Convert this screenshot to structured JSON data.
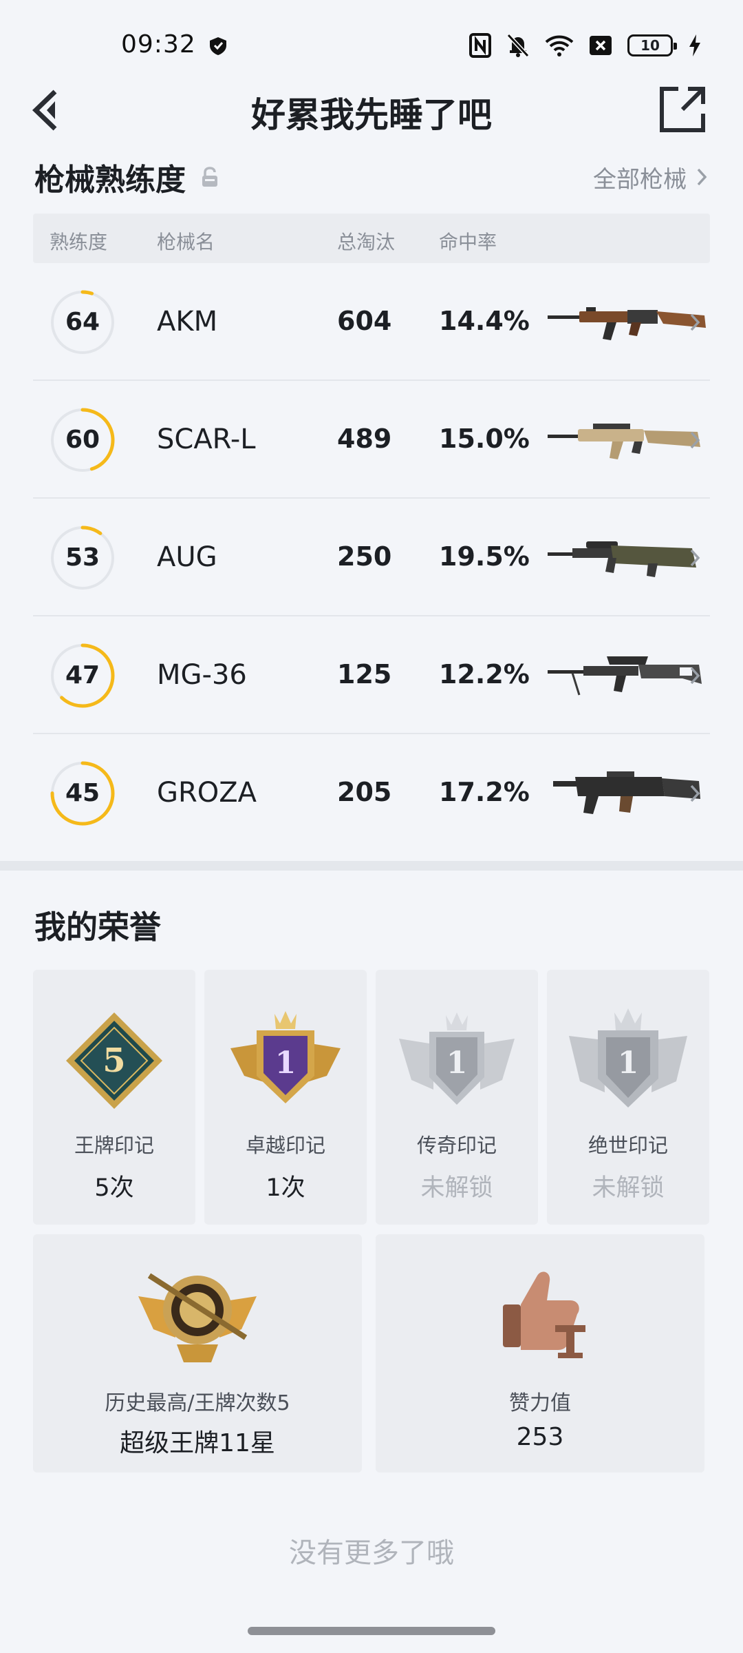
{
  "status_bar": {
    "time": "09:32",
    "battery_level": "10",
    "icons": [
      "shield-icon",
      "nfc-icon",
      "bell-muted-icon",
      "wifi-icon",
      "sim-off-icon",
      "battery-icon",
      "charging-icon"
    ]
  },
  "header": {
    "title": "好累我先睡了吧"
  },
  "weapons_section": {
    "title": "枪械熟练度",
    "all_link": "全部枪械",
    "columns": [
      "熟练度",
      "枪械名",
      "总淘汰",
      "命中率"
    ],
    "rows": [
      {
        "level": "64",
        "name": "AKM",
        "eliminations": "604",
        "hit_rate": "14.4%",
        "progress": 0.05
      },
      {
        "level": "60",
        "name": "SCAR-L",
        "eliminations": "489",
        "hit_rate": "15.0%",
        "progress": 0.45
      },
      {
        "level": "53",
        "name": "AUG",
        "eliminations": "250",
        "hit_rate": "19.5%",
        "progress": 0.1
      },
      {
        "level": "47",
        "name": "MG-36",
        "eliminations": "125",
        "hit_rate": "12.2%",
        "progress": 0.62
      },
      {
        "level": "45",
        "name": "GROZA",
        "eliminations": "205",
        "hit_rate": "17.2%",
        "progress": 0.75
      }
    ],
    "accent_color": "#f5b91a"
  },
  "honors_section": {
    "title": "我的荣誉",
    "badges": [
      {
        "label": "王牌印记",
        "value": "5次",
        "emblem_text": "5",
        "locked": false
      },
      {
        "label": "卓越印记",
        "value": "1次",
        "emblem_text": "1",
        "locked": false
      },
      {
        "label": "传奇印记",
        "value": "未解锁",
        "emblem_text": "1",
        "locked": true
      },
      {
        "label": "绝世印记",
        "value": "未解锁",
        "emblem_text": "1",
        "locked": true
      }
    ],
    "highest": {
      "label": "历史最高/王牌次数5",
      "value": "超级王牌11星"
    },
    "likes": {
      "label": "赞力值",
      "value": "253"
    }
  },
  "footer": {
    "no_more": "没有更多了哦"
  }
}
